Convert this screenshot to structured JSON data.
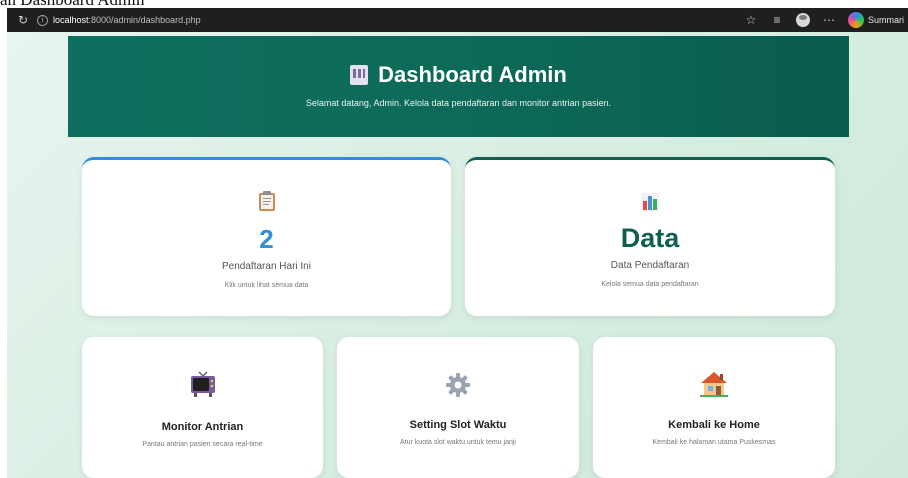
{
  "document_caption": "an Dashboard Admin",
  "browser": {
    "url_host": "localhost",
    "url_rest": ":8000/admin/dashboard.php",
    "summarize_label": "Summari"
  },
  "header": {
    "title": "Dashboard Admin",
    "subtitle": "Selamat datang, Admin. Kelola data pendaftaran dan monitor antrian pasien."
  },
  "cards": {
    "registrations": {
      "value": "2",
      "label": "Pendaftaran Hari Ini",
      "description": "Klik untuk lihat semua data",
      "accent_color": "#2f8fd8"
    },
    "data": {
      "value": "Data",
      "label": "Data Pendaftaran",
      "description": "Kelola semua data pendaftaran",
      "accent_color": "#0f6050"
    },
    "monitor": {
      "title": "Monitor Antrian",
      "description": "Pantau antrian pasien secara real-time"
    },
    "slot": {
      "title": "Setting Slot Waktu",
      "description": "Atur kuota slot waktu untuk temu janji"
    },
    "home": {
      "title": "Kembali ke Home",
      "description": "Kembali ke halaman utama Puskesmas"
    }
  },
  "icons": {
    "header": "hospital-icon",
    "registrations": "clipboard-icon",
    "data": "bar-chart-icon",
    "monitor": "tv-icon",
    "slot": "gear-icon",
    "home": "house-icon"
  }
}
